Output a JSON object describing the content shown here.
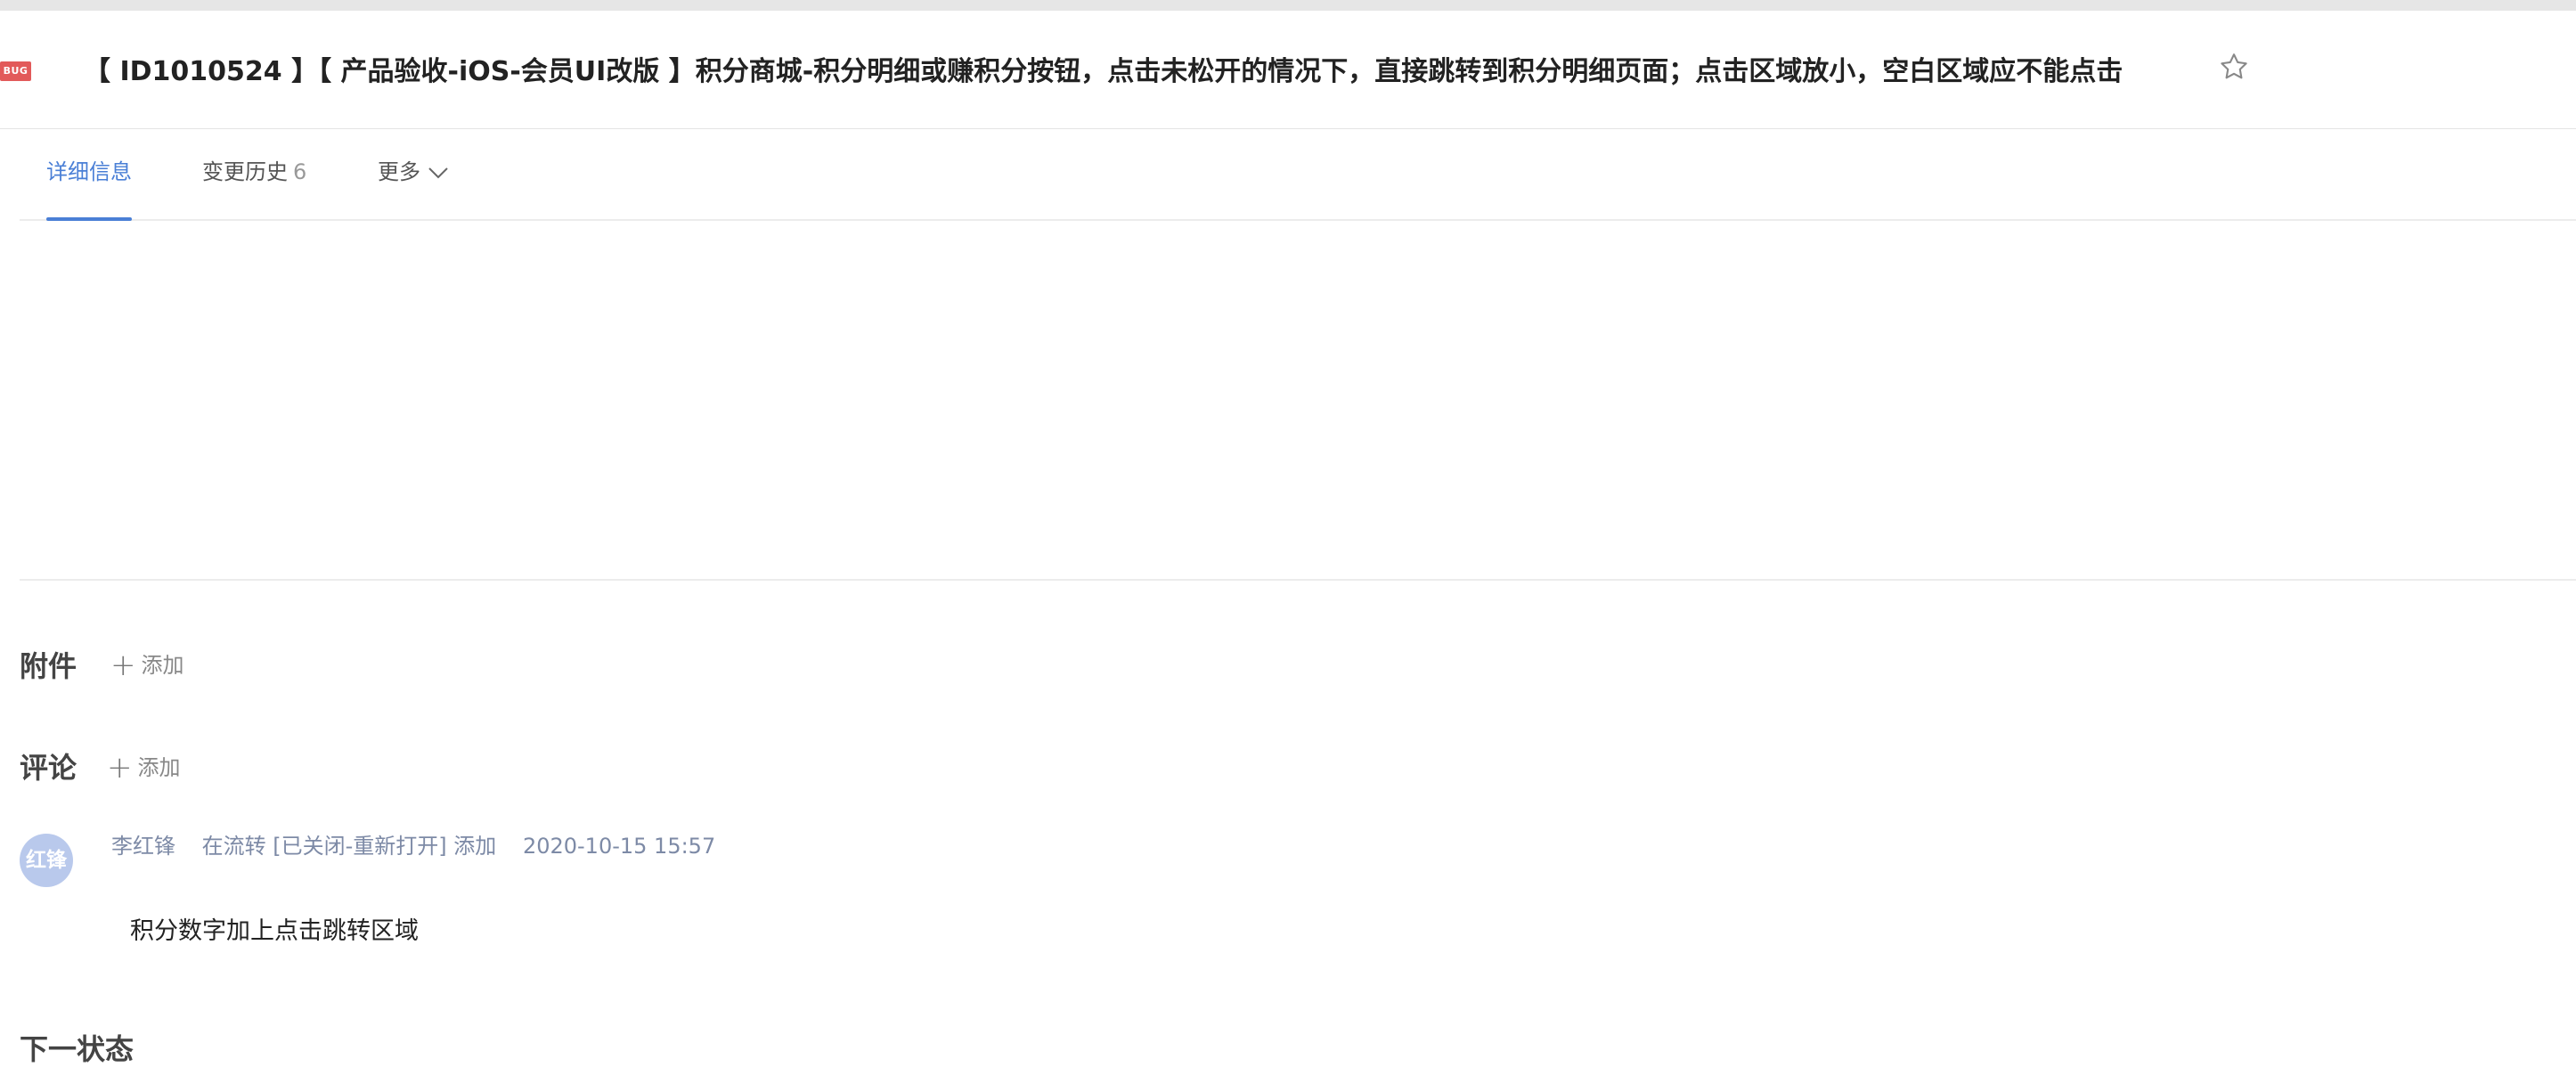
{
  "issue": {
    "badge": "BUG",
    "title": "【 ID1010524 】【 产品验收-iOS-会员UI改版 】积分商城-积分明细或赚积分按钮，点击未松开的情况下，直接跳转到积分明细页面；点击区域放小，空白区域应不能点击"
  },
  "tabs": [
    {
      "label": "详细信息",
      "active": true
    },
    {
      "label": "变更历史",
      "count": "6"
    },
    {
      "label": "更多"
    }
  ],
  "attachments": {
    "heading": "附件",
    "add_label": "添加"
  },
  "comments": {
    "heading": "评论",
    "add_label": "添加",
    "items": [
      {
        "avatar_text": "红锋",
        "author": "李红锋",
        "action": "在流转 [已关闭-重新打开] 添加",
        "timestamp": "2020-10-15 15:57",
        "body": "积分数字加上点击跳转区域"
      }
    ]
  },
  "next_state": {
    "heading": "下一状态"
  },
  "colors": {
    "accent": "#4a7fd6",
    "bug_badge": "#e25a5a",
    "avatar": "#b9c9ec"
  },
  "icons": [
    "bug-badge-icon",
    "star-icon",
    "chevron-down-icon",
    "plus-icon"
  ]
}
